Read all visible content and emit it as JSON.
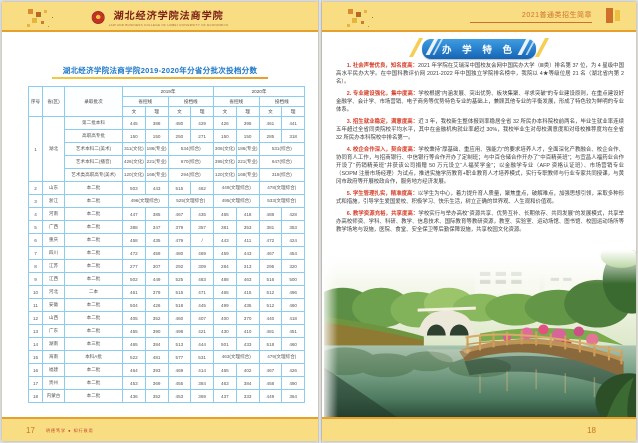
{
  "header": {
    "logo_title": "湖北经济学院法商学院",
    "logo_subtitle": "LAW AND BUSINESS COLLEGE OF HUBEI UNIVERSITY OF ECONOMICS",
    "right_banner": "2021普通类招生简章"
  },
  "left_page": {
    "table_title": "湖北经济学院法商学院2019-2020年分省分批次投档分数",
    "table": {
      "header_rows": [
        [
          [
            "序号",
            1,
            3
          ],
          [
            "省(区)",
            1,
            3
          ],
          [
            "录取批次",
            1,
            3
          ],
          [
            "2019年",
            4,
            1
          ],
          [
            "2020年",
            4,
            1
          ]
        ],
        [
          [
            "省控线",
            2,
            1
          ],
          [
            "投档线",
            2,
            1
          ],
          [
            "省控线",
            2,
            1
          ],
          [
            "投档线",
            2,
            1
          ]
        ],
        [
          [
            "文",
            1,
            1
          ],
          [
            "理",
            1,
            1
          ],
          [
            "文",
            1,
            1
          ],
          [
            "理",
            1,
            1
          ],
          [
            "文",
            1,
            1
          ],
          [
            "理",
            1,
            1
          ],
          [
            "文",
            1,
            1
          ],
          [
            "理",
            1,
            1
          ]
        ]
      ],
      "rows": [
        {
          "no": "1",
          "no_span": 5,
          "province": "湖北",
          "prov_span": 5,
          "batch": "第二批本科",
          "cells": [
            [
              "445",
              1
            ],
            [
              "388",
              1
            ],
            [
              "480",
              1
            ],
            [
              "429",
              1
            ],
            [
              "426",
              1
            ],
            [
              "395",
              1
            ],
            [
              "461",
              1
            ],
            [
              "441",
              1
            ]
          ]
        },
        {
          "batch": "高职高专批",
          "cells": [
            [
              "150",
              1
            ],
            [
              "150",
              1
            ],
            [
              "250",
              1
            ],
            [
              "271",
              1
            ],
            [
              "150",
              1
            ],
            [
              "150",
              1
            ],
            [
              "285",
              1
            ],
            [
              "318",
              1
            ]
          ]
        },
        {
          "batch": "艺术本科二(美术)",
          "cells": [
            [
              "311(文化)",
              1
            ],
            [
              "186(专业)",
              1
            ],
            [
              "534(综合)",
              2
            ],
            [
              "306(文化)",
              1
            ],
            [
              "186(专业)",
              1
            ],
            [
              "531(综合)",
              2
            ]
          ]
        },
        {
          "batch": "艺术本科二(播音)",
          "cells": [
            [
              "426(文化)",
              1
            ],
            [
              "221(专业)",
              1
            ],
            [
              "670(综合)",
              2
            ],
            [
              "395(文化)",
              1
            ],
            [
              "221(专业)",
              1
            ],
            [
              "647(综合)",
              2
            ]
          ]
        },
        {
          "batch": "艺术类高职高专(美术)",
          "cells": [
            [
              "120(文化)",
              1
            ],
            [
              "168(专业)",
              1
            ],
            [
              "294(综合)",
              2
            ],
            [
              "120(文化)",
              1
            ],
            [
              "168(专业)",
              1
            ],
            [
              "318(综合)",
              2
            ]
          ]
        },
        {
          "no": "2",
          "province": "山东",
          "batch": "本二批",
          "cells": [
            [
              "503",
              1
            ],
            [
              "443",
              1
            ],
            [
              "515",
              1
            ],
            [
              "462",
              1
            ],
            [
              "449(文理综合)",
              2
            ],
            [
              "478(文理综合)",
              2
            ]
          ]
        },
        {
          "no": "3",
          "province": "浙江",
          "batch": "本二批",
          "cells": [
            [
              "496(文理综合)",
              2
            ],
            [
              "525(文理综合)",
              2
            ],
            [
              "495(文理综合)",
              2
            ],
            [
              "533(文理综合)",
              2
            ]
          ]
        },
        {
          "no": "4",
          "province": "河南",
          "batch": "本二批",
          "cells": [
            [
              "447",
              1
            ],
            [
              "385",
              1
            ],
            [
              "467",
              1
            ],
            [
              "435",
              1
            ],
            [
              "465",
              1
            ],
            [
              "418",
              1
            ],
            [
              "488",
              1
            ],
            [
              "428",
              1
            ]
          ]
        },
        {
          "no": "5",
          "province": "广西",
          "batch": "本二批",
          "cells": [
            [
              "388",
              1
            ],
            [
              "347",
              1
            ],
            [
              "379",
              1
            ],
            [
              "357",
              1
            ],
            [
              "381",
              1
            ],
            [
              "353",
              1
            ],
            [
              "381",
              1
            ],
            [
              "353",
              1
            ]
          ]
        },
        {
          "no": "6",
          "province": "重庆",
          "batch": "本二批",
          "cells": [
            [
              "458",
              1
            ],
            [
              "435",
              1
            ],
            [
              "479",
              1
            ],
            [
              "/",
              1
            ],
            [
              "443",
              1
            ],
            [
              "411",
              1
            ],
            [
              "472",
              1
            ],
            [
              "424",
              1
            ]
          ]
        },
        {
          "no": "7",
          "province": "四川",
          "batch": "本二批",
          "cells": [
            [
              "472",
              1
            ],
            [
              "459",
              1
            ],
            [
              "480",
              1
            ],
            [
              "469",
              1
            ],
            [
              "459",
              1
            ],
            [
              "443",
              1
            ],
            [
              "467",
              1
            ],
            [
              "454",
              1
            ]
          ]
        },
        {
          "no": "8",
          "province": "江苏",
          "batch": "本二批",
          "cells": [
            [
              "277",
              1
            ],
            [
              "307",
              1
            ],
            [
              "292",
              1
            ],
            [
              "309",
              1
            ],
            [
              "284",
              1
            ],
            [
              "313",
              1
            ],
            [
              "295",
              1
            ],
            [
              "320",
              1
            ]
          ]
        },
        {
          "no": "9",
          "province": "江西",
          "batch": "本二批",
          "cells": [
            [
              "502",
              1
            ],
            [
              "449",
              1
            ],
            [
              "525",
              1
            ],
            [
              "483",
              1
            ],
            [
              "488",
              1
            ],
            [
              "463",
              1
            ],
            [
              "516",
              1
            ],
            [
              "500",
              1
            ]
          ]
        },
        {
          "no": "10",
          "province": "河北",
          "batch": "二本",
          "cells": [
            [
              "461",
              1
            ],
            [
              "379",
              1
            ],
            [
              "515",
              1
            ],
            [
              "471",
              1
            ],
            [
              "465",
              1
            ],
            [
              "415",
              1
            ],
            [
              "512",
              1
            ],
            [
              "496",
              1
            ]
          ]
        },
        {
          "no": "11",
          "province": "安徽",
          "batch": "本二批",
          "cells": [
            [
              "504",
              1
            ],
            [
              "426",
              1
            ],
            [
              "518",
              1
            ],
            [
              "445",
              1
            ],
            [
              "499",
              1
            ],
            [
              "435",
              1
            ],
            [
              "512",
              1
            ],
            [
              "460",
              1
            ]
          ]
        },
        {
          "no": "12",
          "province": "山西",
          "batch": "本二批",
          "cells": [
            [
              "405",
              1
            ],
            [
              "352",
              1
            ],
            [
              "460",
              1
            ],
            [
              "407",
              1
            ],
            [
              "400",
              1
            ],
            [
              "370",
              1
            ],
            [
              "440",
              1
            ],
            [
              "418",
              1
            ]
          ]
        },
        {
          "no": "13",
          "province": "广东",
          "batch": "本二批",
          "cells": [
            [
              "455",
              1
            ],
            [
              "390",
              1
            ],
            [
              "498",
              1
            ],
            [
              "421",
              1
            ],
            [
              "430",
              1
            ],
            [
              "410",
              1
            ],
            [
              "481",
              1
            ],
            [
              "451",
              1
            ]
          ]
        },
        {
          "no": "14",
          "province": "湖南",
          "batch": "本三批",
          "cells": [
            [
              "465",
              1
            ],
            [
              "384",
              1
            ],
            [
              "513",
              1
            ],
            [
              "444",
              1
            ],
            [
              "501",
              1
            ],
            [
              "433",
              1
            ],
            [
              "518",
              1
            ],
            [
              "460",
              1
            ]
          ]
        },
        {
          "no": "15",
          "province": "海南",
          "batch": "本科A批",
          "cells": [
            [
              "522",
              1
            ],
            [
              "481",
              1
            ],
            [
              "577",
              1
            ],
            [
              "531",
              1
            ],
            [
              "463(文理综合)",
              2
            ],
            [
              "479(文理综合)",
              2
            ]
          ]
        },
        {
          "no": "16",
          "province": "福建",
          "batch": "本二批",
          "cells": [
            [
              "464",
              1
            ],
            [
              "393",
              1
            ],
            [
              "469",
              1
            ],
            [
              "414",
              1
            ],
            [
              "465",
              1
            ],
            [
              "402",
              1
            ],
            [
              "467",
              1
            ],
            [
              "426",
              1
            ]
          ]
        },
        {
          "no": "17",
          "province": "贵州",
          "batch": "本二批",
          "cells": [
            [
              "453",
              1
            ],
            [
              "369",
              1
            ],
            [
              "455",
              1
            ],
            [
              "384",
              1
            ],
            [
              "463",
              1
            ],
            [
              "384",
              1
            ],
            [
              "458",
              1
            ],
            [
              "490",
              1
            ]
          ]
        },
        {
          "no": "18",
          "province": "内蒙古",
          "batch": "本二批",
          "cells": [
            [
              "436",
              1
            ],
            [
              "352",
              1
            ],
            [
              "453",
              1
            ],
            [
              "369",
              1
            ],
            [
              "437",
              1
            ],
            [
              "333",
              1
            ],
            [
              "449",
              1
            ],
            [
              "364",
              1
            ]
          ]
        }
      ]
    },
    "footer": {
      "page_number": "17",
      "motto": "明德笃学 ● 知行致用"
    }
  },
  "right_page": {
    "section_title": "办 学 特 色",
    "paragraphs": [
      {
        "lead": "1. 社会声誉优良，知名度高：",
        "body": "2021 年学院在艾瑞深中国校友会网中国民办大学（Ⅲ类）排名第 37 位，为 4 星级中国高水平民办大学。在中国科教评价网 2021-2022 年中国独立学院排名榜中，我院以 4★等级位居 21 名（湖北省内第 2 名）。"
      },
      {
        "lead": "2. 专业建设强化，集中度高：",
        "body": "学校根据“内涵发展、突出优势、板块集聚、寻求突破”的专业建设原则，在重点建设好金融学、会计学、市场营销、电子商务等优势特色专业的基础上，兼顾其他专业的平衡发展，形成了特色较为鲜明的专业体系。"
      },
      {
        "lead": "3. 招生就业稳定，满意度高：",
        "body": "近 3 年，我校新生整体报到率稳居全省 32 所民办本科院校前两名，毕业生就业率连续五年超过全省同类院校平均水平，其中在金融机构就业率超过 30%，我校毕业生对母校满意度和对母校推荐度均在全省 32 所民办本科院校中排名第一。"
      },
      {
        "lead": "4. 校企合作深入，契合度高：",
        "body": "学校秉持“厚基础、重应用、强能力”的要求培养人才，全面深化产教融合、校企合作、协同育人工作，与招商银行、中信银行等合作开办了定制班；与中百仓储合作开办了“中百精英班”；与宜昌人福药业合作开设了“药销精英班”并获该公司捐赠 50 万元设立“人福奖学金”；以金融学专业（AFP 资格认证班）、市场营销专业（SOPM 注册市场经理）为试点，推进实施学历教育+职业教育人才培养模式，实行专职教师与行业专家共同授课，与黄冈市政府等开展校政合作，服务地方经济发展。"
      },
      {
        "lead": "5. 学生管理扎实，精准度高：",
        "body": "以学生为中心，着力提升育人质量，聚焦重点，破解难点，加强思想引领，采取多种形式和措施，引导学生爱国爱校、积极学习、快乐生活，树立正确的世界观、人生观和价值观。"
      },
      {
        "lead": "6. 教学资源充裕，共享度高：",
        "body": "学校实行与举办高校“资源共享、优势互补、长期依存、共同发展”的发展模式，共享举办高校师资、学科、科研、教学、信息技术、国际教育等教研资源，教室、实验室、运动场馆、图书馆、校园运动场所等教学场地与设施，医院、食堂、安全保卫等后勤保障设施，共享校园文化资源。"
      }
    ],
    "footer": {
      "page_number": "18"
    }
  }
}
